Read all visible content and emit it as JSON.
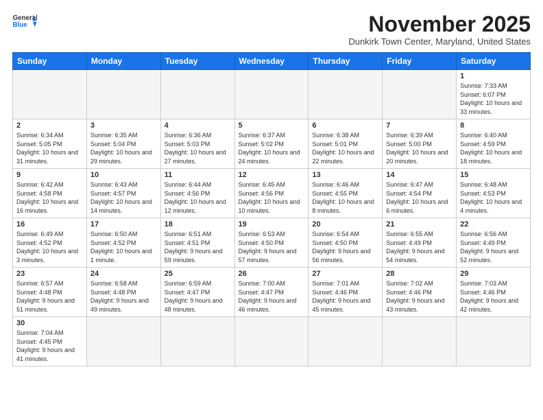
{
  "logo": {
    "line1": "General",
    "line2": "Blue"
  },
  "title": "November 2025",
  "subtitle": "Dunkirk Town Center, Maryland, United States",
  "days_header": [
    "Sunday",
    "Monday",
    "Tuesday",
    "Wednesday",
    "Thursday",
    "Friday",
    "Saturday"
  ],
  "weeks": [
    [
      {
        "day": "",
        "info": ""
      },
      {
        "day": "",
        "info": ""
      },
      {
        "day": "",
        "info": ""
      },
      {
        "day": "",
        "info": ""
      },
      {
        "day": "",
        "info": ""
      },
      {
        "day": "",
        "info": ""
      },
      {
        "day": "1",
        "info": "Sunrise: 7:33 AM\nSunset: 6:07 PM\nDaylight: 10 hours and 33 minutes."
      }
    ],
    [
      {
        "day": "2",
        "info": "Sunrise: 6:34 AM\nSunset: 5:05 PM\nDaylight: 10 hours and 31 minutes."
      },
      {
        "day": "3",
        "info": "Sunrise: 6:35 AM\nSunset: 5:04 PM\nDaylight: 10 hours and 29 minutes."
      },
      {
        "day": "4",
        "info": "Sunrise: 6:36 AM\nSunset: 5:03 PM\nDaylight: 10 hours and 27 minutes."
      },
      {
        "day": "5",
        "info": "Sunrise: 6:37 AM\nSunset: 5:02 PM\nDaylight: 10 hours and 24 minutes."
      },
      {
        "day": "6",
        "info": "Sunrise: 6:38 AM\nSunset: 5:01 PM\nDaylight: 10 hours and 22 minutes."
      },
      {
        "day": "7",
        "info": "Sunrise: 6:39 AM\nSunset: 5:00 PM\nDaylight: 10 hours and 20 minutes."
      },
      {
        "day": "8",
        "info": "Sunrise: 6:40 AM\nSunset: 4:59 PM\nDaylight: 10 hours and 18 minutes."
      }
    ],
    [
      {
        "day": "9",
        "info": "Sunrise: 6:42 AM\nSunset: 4:58 PM\nDaylight: 10 hours and 16 minutes."
      },
      {
        "day": "10",
        "info": "Sunrise: 6:43 AM\nSunset: 4:57 PM\nDaylight: 10 hours and 14 minutes."
      },
      {
        "day": "11",
        "info": "Sunrise: 6:44 AM\nSunset: 4:56 PM\nDaylight: 10 hours and 12 minutes."
      },
      {
        "day": "12",
        "info": "Sunrise: 6:45 AM\nSunset: 4:56 PM\nDaylight: 10 hours and 10 minutes."
      },
      {
        "day": "13",
        "info": "Sunrise: 6:46 AM\nSunset: 4:55 PM\nDaylight: 10 hours and 8 minutes."
      },
      {
        "day": "14",
        "info": "Sunrise: 6:47 AM\nSunset: 4:54 PM\nDaylight: 10 hours and 6 minutes."
      },
      {
        "day": "15",
        "info": "Sunrise: 6:48 AM\nSunset: 4:53 PM\nDaylight: 10 hours and 4 minutes."
      }
    ],
    [
      {
        "day": "16",
        "info": "Sunrise: 6:49 AM\nSunset: 4:52 PM\nDaylight: 10 hours and 3 minutes."
      },
      {
        "day": "17",
        "info": "Sunrise: 6:50 AM\nSunset: 4:52 PM\nDaylight: 10 hours and 1 minute."
      },
      {
        "day": "18",
        "info": "Sunrise: 6:51 AM\nSunset: 4:51 PM\nDaylight: 9 hours and 59 minutes."
      },
      {
        "day": "19",
        "info": "Sunrise: 6:53 AM\nSunset: 4:50 PM\nDaylight: 9 hours and 57 minutes."
      },
      {
        "day": "20",
        "info": "Sunrise: 6:54 AM\nSunset: 4:50 PM\nDaylight: 9 hours and 56 minutes."
      },
      {
        "day": "21",
        "info": "Sunrise: 6:55 AM\nSunset: 4:49 PM\nDaylight: 9 hours and 54 minutes."
      },
      {
        "day": "22",
        "info": "Sunrise: 6:56 AM\nSunset: 4:49 PM\nDaylight: 9 hours and 52 minutes."
      }
    ],
    [
      {
        "day": "23",
        "info": "Sunrise: 6:57 AM\nSunset: 4:48 PM\nDaylight: 9 hours and 51 minutes."
      },
      {
        "day": "24",
        "info": "Sunrise: 6:58 AM\nSunset: 4:48 PM\nDaylight: 9 hours and 49 minutes."
      },
      {
        "day": "25",
        "info": "Sunrise: 6:59 AM\nSunset: 4:47 PM\nDaylight: 9 hours and 48 minutes."
      },
      {
        "day": "26",
        "info": "Sunrise: 7:00 AM\nSunset: 4:47 PM\nDaylight: 9 hours and 46 minutes."
      },
      {
        "day": "27",
        "info": "Sunrise: 7:01 AM\nSunset: 4:46 PM\nDaylight: 9 hours and 45 minutes."
      },
      {
        "day": "28",
        "info": "Sunrise: 7:02 AM\nSunset: 4:46 PM\nDaylight: 9 hours and 43 minutes."
      },
      {
        "day": "29",
        "info": "Sunrise: 7:03 AM\nSunset: 4:46 PM\nDaylight: 9 hours and 42 minutes."
      }
    ],
    [
      {
        "day": "30",
        "info": "Sunrise: 7:04 AM\nSunset: 4:45 PM\nDaylight: 9 hours and 41 minutes."
      },
      {
        "day": "",
        "info": ""
      },
      {
        "day": "",
        "info": ""
      },
      {
        "day": "",
        "info": ""
      },
      {
        "day": "",
        "info": ""
      },
      {
        "day": "",
        "info": ""
      },
      {
        "day": "",
        "info": ""
      }
    ]
  ]
}
